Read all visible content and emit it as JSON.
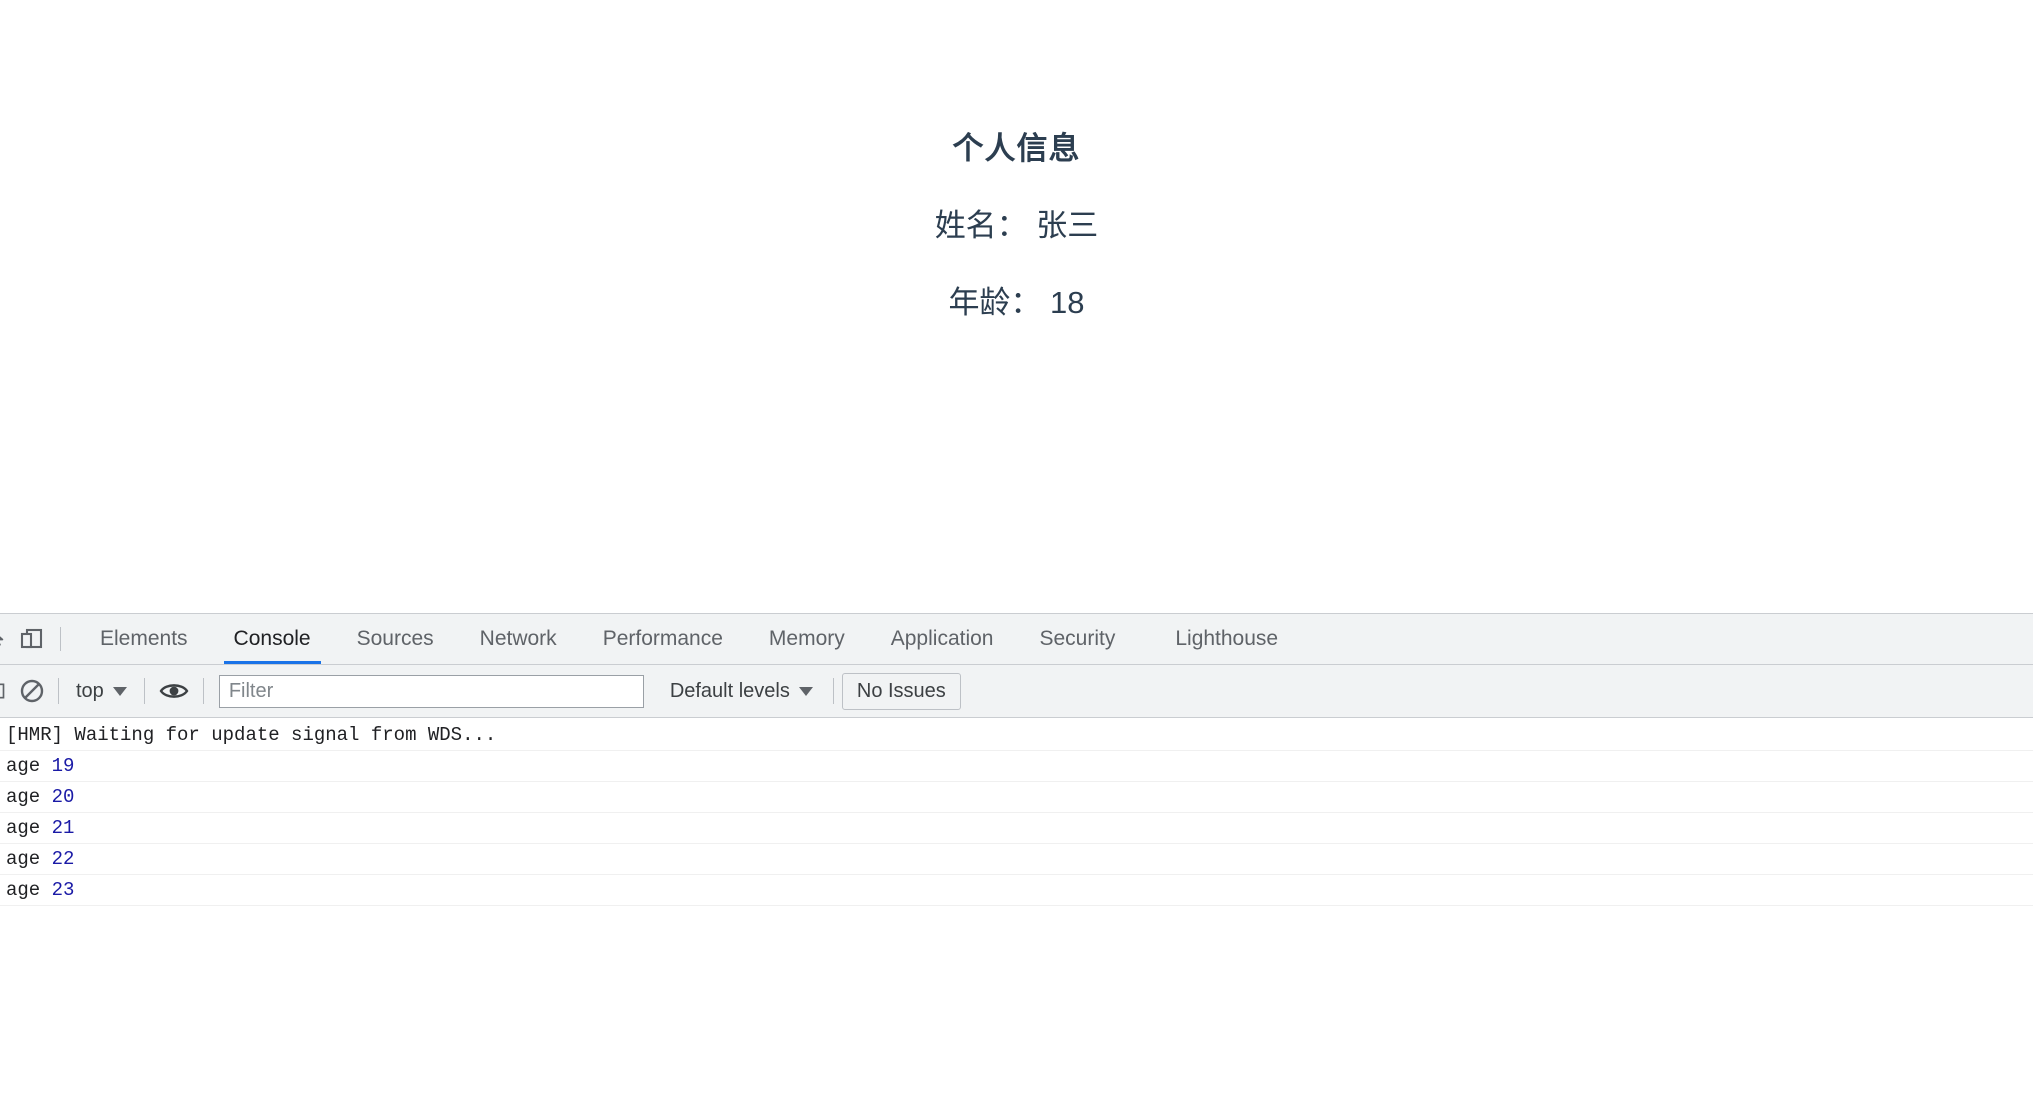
{
  "page": {
    "title": "个人信息",
    "fields": [
      {
        "label": "姓名：",
        "value": "张三",
        "line": "姓名： 张三"
      },
      {
        "label": "年龄：",
        "value": "18",
        "line": "年龄： 18"
      }
    ],
    "text_color": "#2c3e50",
    "background": "#ffffff"
  },
  "devtools": {
    "accent_color": "#1a73e8",
    "toolbar_background": "#f1f3f4",
    "tabs": [
      {
        "label": "Elements",
        "active": false
      },
      {
        "label": "Console",
        "active": true
      },
      {
        "label": "Sources",
        "active": false
      },
      {
        "label": "Network",
        "active": false
      },
      {
        "label": "Performance",
        "active": false
      },
      {
        "label": "Memory",
        "active": false
      },
      {
        "label": "Application",
        "active": false
      },
      {
        "label": "Security",
        "active": false
      },
      {
        "label": "Lighthouse",
        "active": false
      }
    ],
    "icons": {
      "inspect": "inspect-element-icon",
      "device": "device-toolbar-icon",
      "sidebar": "console-sidebar-icon",
      "clear": "clear-console-icon",
      "eye": "live-expression-icon"
    },
    "console_toolbar": {
      "context": "top",
      "filter_placeholder": "Filter",
      "filter_value": "",
      "levels": "Default levels",
      "issues": "No Issues"
    },
    "console_messages": [
      {
        "text": "[HMR] Waiting for update signal from WDS...",
        "number": ""
      },
      {
        "text": "age ",
        "number": "19"
      },
      {
        "text": "age ",
        "number": "20"
      },
      {
        "text": "age ",
        "number": "21"
      },
      {
        "text": "age ",
        "number": "22"
      },
      {
        "text": "age ",
        "number": "23"
      }
    ]
  }
}
